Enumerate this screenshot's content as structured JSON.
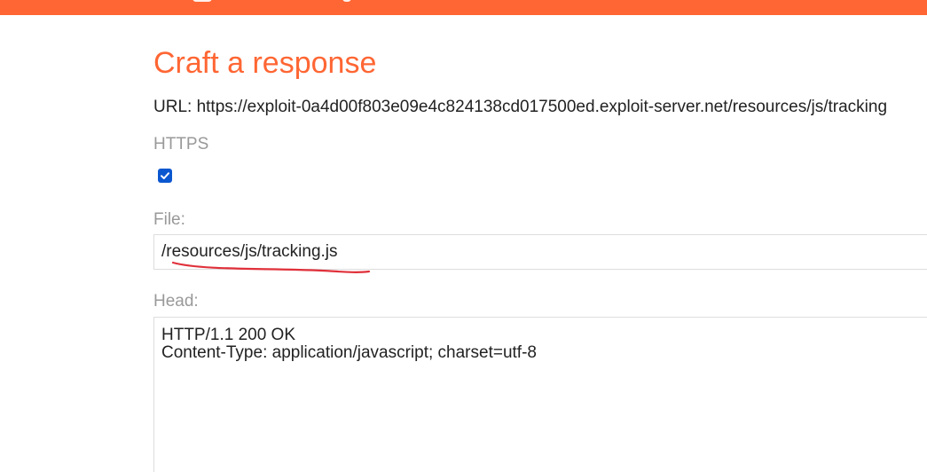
{
  "colors": {
    "brand": "#ff6633",
    "text": "#222222",
    "label": "#999999",
    "checkbox": "#0b57d0",
    "annotation": "#e0303a"
  },
  "form": {
    "title": "Craft a response",
    "url_text": "URL: https://exploit-0a4d00f803e09e4c824138cd017500ed.exploit-server.net/resources/js/tracking",
    "https_label": "HTTPS",
    "https_checked": true,
    "file_label": "File:",
    "file_value": "/resources/js/tracking.js",
    "head_label": "Head:",
    "head_value": "HTTP/1.1 200 OK\nContent-Type: application/javascript; charset=utf-8"
  },
  "icons": {
    "checkbox": "check-icon",
    "annotation": "red-underline-annotation"
  }
}
